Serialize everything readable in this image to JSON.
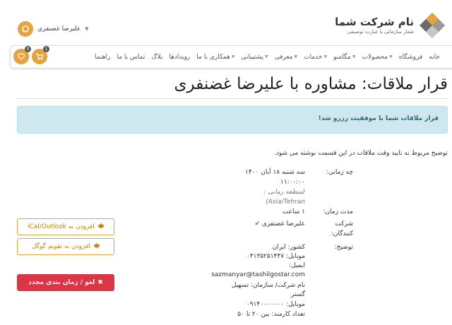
{
  "brand": {
    "name": "نام شرکت شما",
    "tagline": "شعار سازمانی یا عبارت توصیفی"
  },
  "user": {
    "name": "علیرضا غضنفری"
  },
  "nav": {
    "items": [
      {
        "label": "خانه",
        "dropdown": false
      },
      {
        "label": "فروشگاه",
        "dropdown": false
      },
      {
        "label": "محصولات",
        "dropdown": true
      },
      {
        "label": "مگامنو",
        "dropdown": true
      },
      {
        "label": "خدمات",
        "dropdown": true
      },
      {
        "label": "معرفی",
        "dropdown": true
      },
      {
        "label": "پشتیبانی",
        "dropdown": true
      },
      {
        "label": "همکاری با ما",
        "dropdown": true
      },
      {
        "label": "رویدادها",
        "dropdown": false
      },
      {
        "label": "بلاگ",
        "dropdown": false
      },
      {
        "label": "تماس با ما",
        "dropdown": false
      },
      {
        "label": "راهنما",
        "dropdown": false
      }
    ],
    "cart_count": "1",
    "wishlist_count": "0"
  },
  "page": {
    "title": "قرار ملاقات: مشاوره با علیرضا غضنفری",
    "alert": "قرار ملاقات شما با موفقیت رزرو شد!",
    "intro": "توضیح مربوط به تایید وقت ملاقات در این قسمت نوشته می شود."
  },
  "details": {
    "when_label": "چه زمانی:",
    "when_date": "سه شنبه ۱۸ آبان ۱۴۰۰",
    "when_time": "۱۱:۰۰:۰۰",
    "timezone_label": "(منطقه زمانی :",
    "timezone_value": "Asia/Tehran)",
    "duration_label": "مدت زمان:",
    "duration_value": "۱ ساعت",
    "participants_label_1": "شرکت",
    "participants_label_2": "کنندگان:",
    "participant": "علیرضا غضنفری",
    "desc_label": "توضیح:",
    "desc_lines": [
      "کشور: ایران",
      "موبایل: ۰۴۱۳۵۲۵۱۴۴۷",
      "ایمیل:",
      "sazmanyar@tashilgostar.com",
      "نام شرکت/ سازمان: تسهیل",
      "گستر",
      "موبایل: ۰۹۱۴۰۰۰۰۰۰۰",
      "تعداد کارمند: بین ۲۰ تا ۵۰"
    ]
  },
  "actions": {
    "ical": "افزودن به iCal/Outlook",
    "google": "افزودن به تقویم گوگل",
    "cancel": "لغو / زمان بندی مجدد"
  }
}
